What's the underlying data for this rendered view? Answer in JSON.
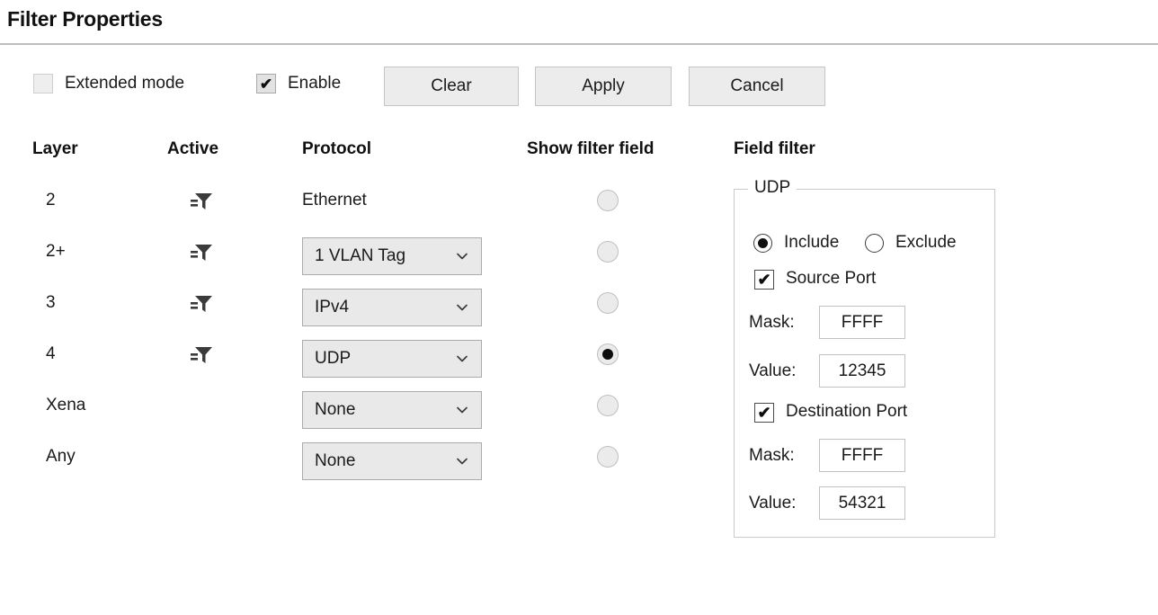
{
  "header": {
    "title": "Filter Properties"
  },
  "toolbar": {
    "extended_mode": {
      "label": "Extended mode",
      "checked": false
    },
    "enable": {
      "label": "Enable",
      "checked": true
    },
    "buttons": [
      {
        "label": "Clear"
      },
      {
        "label": "Apply"
      },
      {
        "label": "Cancel"
      }
    ]
  },
  "columns": {
    "layer": "Layer",
    "active": "Active",
    "protocol": "Protocol",
    "show_filter_field": "Show filter field",
    "field_filter": "Field filter"
  },
  "rows": [
    {
      "layer": "2",
      "active_icon": "filter-funnel-icon",
      "protocol_kind": "static",
      "protocol": "Ethernet",
      "show_filter_field": false
    },
    {
      "layer": "2+",
      "active_icon": "filter-funnel-icon",
      "protocol_kind": "dropdown",
      "protocol": "1 VLAN Tag",
      "show_filter_field": false
    },
    {
      "layer": "3",
      "active_icon": "filter-funnel-icon",
      "protocol_kind": "dropdown",
      "protocol": "IPv4",
      "show_filter_field": false
    },
    {
      "layer": "4",
      "active_icon": "filter-funnel-icon",
      "protocol_kind": "dropdown",
      "protocol": "UDP",
      "show_filter_field": true
    },
    {
      "layer": "Xena",
      "active_icon": "none",
      "protocol_kind": "dropdown",
      "protocol": "None",
      "show_filter_field": false
    },
    {
      "layer": "Any",
      "active_icon": "none",
      "protocol_kind": "dropdown",
      "protocol": "None",
      "show_filter_field": false
    }
  ],
  "field_filter_group": {
    "legend": "UDP",
    "include": {
      "label": "Include",
      "selected": true
    },
    "exclude": {
      "label": "Exclude",
      "selected": false
    },
    "source_port": {
      "label": "Source Port",
      "checked": true,
      "mask_label": "Mask:",
      "mask_value": "FFFF",
      "value_label": "Value:",
      "value_value": "12345"
    },
    "destination_port": {
      "label": "Destination Port",
      "checked": true,
      "mask_label": "Mask:",
      "mask_value": "FFFF",
      "value_label": "Value:",
      "value_value": "54321"
    }
  },
  "colors": {
    "background": "#ffffff",
    "text": "#1a1a1a",
    "rule": "#bdbdbd",
    "button_face": "#ececec",
    "button_border": "#c4c4c4",
    "dropdown_face": "#e9e9e9",
    "dropdown_border": "#ababab",
    "input_border": "#c2c2c2",
    "groupbox_border": "#c9c9c9",
    "selected_dot": "#0d0d0d"
  },
  "icons": {
    "tick": "✔",
    "funnel": "filter-funnel-icon",
    "chevron": "chevron-down-icon"
  }
}
